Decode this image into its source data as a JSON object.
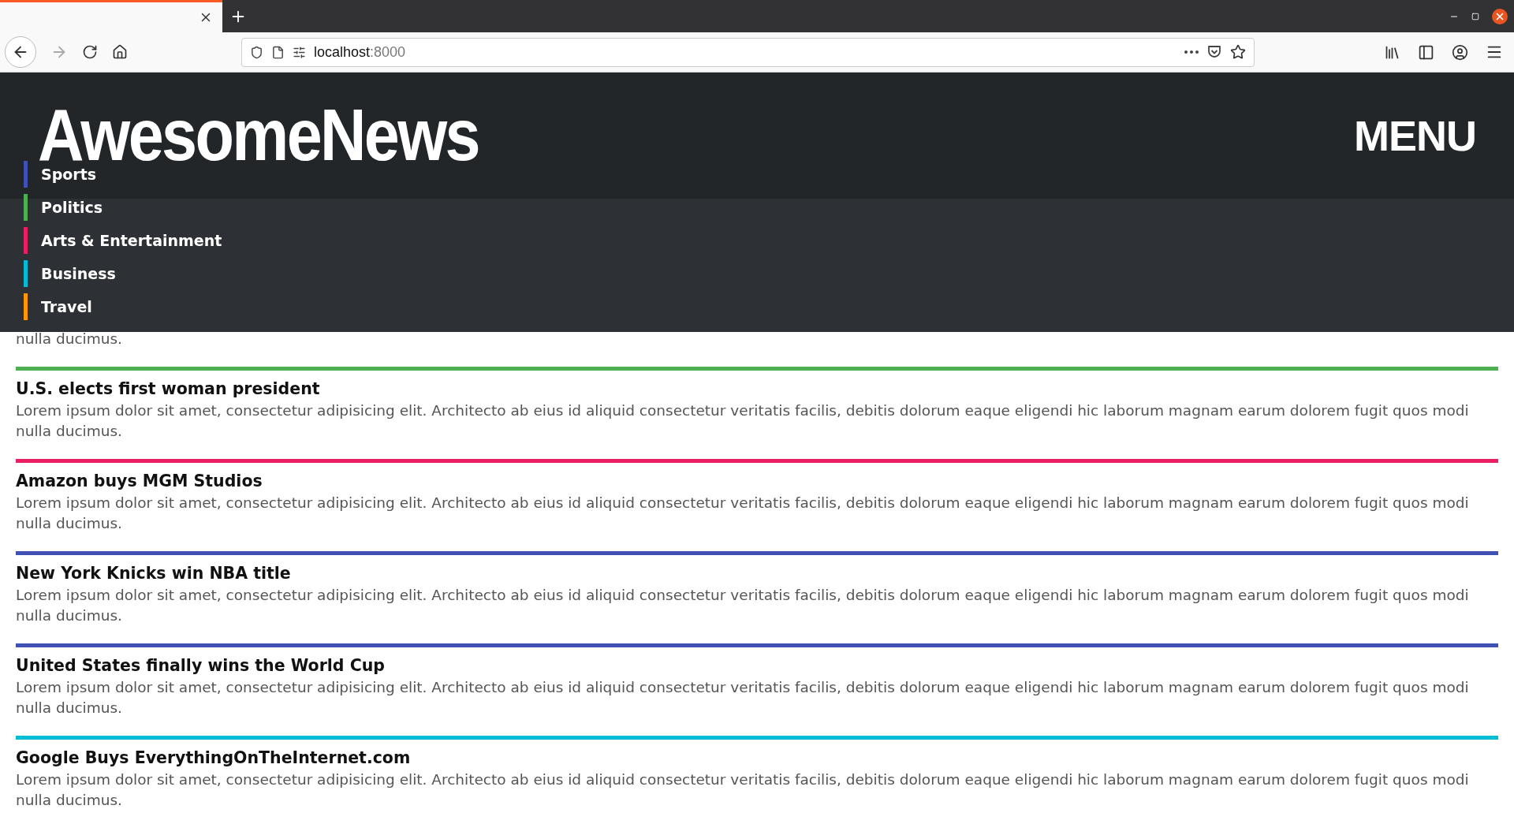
{
  "browser": {
    "url": {
      "host": "localhost",
      "port": ":8000"
    }
  },
  "site": {
    "title": "AwesomeNews",
    "menu_button": "MENU"
  },
  "nav": [
    {
      "label": "Sports",
      "color": "#3f51b5"
    },
    {
      "label": "Politics",
      "color": "#4caf50"
    },
    {
      "label": "Arts & Entertainment",
      "color": "#e91e63"
    },
    {
      "label": "Business",
      "color": "#00bcd4"
    },
    {
      "label": "Travel",
      "color": "#ff9800"
    }
  ],
  "covered_article": {
    "visible_text": "nulla ducimus."
  },
  "articles": [
    {
      "title": "U.S. elects first woman president",
      "summary": "Lorem ipsum dolor sit amet, consectetur adipisicing elit. Architecto ab eius id aliquid consectetur veritatis facilis, debitis dolorum eaque eligendi hic laborum magnam earum dolorem fugit quos modi nulla ducimus.",
      "color": "#4caf50"
    },
    {
      "title": "Amazon buys MGM Studios",
      "summary": "Lorem ipsum dolor sit amet, consectetur adipisicing elit. Architecto ab eius id aliquid consectetur veritatis facilis, debitis dolorum eaque eligendi hic laborum magnam earum dolorem fugit quos modi nulla ducimus.",
      "color": "#e91e63"
    },
    {
      "title": "New York Knicks win NBA title",
      "summary": "Lorem ipsum dolor sit amet, consectetur adipisicing elit. Architecto ab eius id aliquid consectetur veritatis facilis, debitis dolorum eaque eligendi hic laborum magnam earum dolorem fugit quos modi nulla ducimus.",
      "color": "#3f51b5"
    },
    {
      "title": "United States finally wins the World Cup",
      "summary": "Lorem ipsum dolor sit amet, consectetur adipisicing elit. Architecto ab eius id aliquid consectetur veritatis facilis, debitis dolorum eaque eligendi hic laborum magnam earum dolorem fugit quos modi nulla ducimus.",
      "color": "#3f51b5"
    },
    {
      "title": "Google Buys EverythingOnTheInternet.com",
      "summary": "Lorem ipsum dolor sit amet, consectetur adipisicing elit. Architecto ab eius id aliquid consectetur veritatis facilis, debitis dolorum eaque eligendi hic laborum magnam earum dolorem fugit quos modi nulla ducimus.",
      "color": "#00bcd4"
    }
  ]
}
